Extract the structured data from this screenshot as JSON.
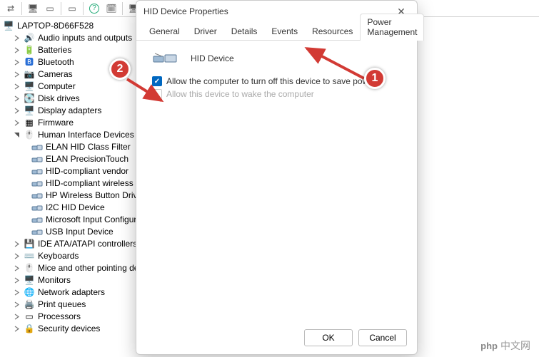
{
  "toolbar": {
    "icons": [
      "arrow",
      "monitor",
      "square",
      "square",
      "help",
      "calendar",
      "device"
    ]
  },
  "computer_name": "LAPTOP-8D66F528",
  "tree": [
    {
      "label": "Audio inputs and outputs",
      "kind": "speaker",
      "exp": true
    },
    {
      "label": "Batteries",
      "kind": "battery",
      "exp": true
    },
    {
      "label": "Bluetooth",
      "kind": "bt",
      "exp": true
    },
    {
      "label": "Cameras",
      "kind": "camera",
      "exp": true
    },
    {
      "label": "Computer",
      "kind": "computer",
      "exp": true
    },
    {
      "label": "Disk drives",
      "kind": "disk",
      "exp": true
    },
    {
      "label": "Display adapters",
      "kind": "display",
      "exp": true
    },
    {
      "label": "Firmware",
      "kind": "firmware",
      "exp": true
    },
    {
      "label": "Human Interface Devices",
      "kind": "hid",
      "exp": true,
      "open": true,
      "children": [
        {
          "label": "ELAN HID Class Filter"
        },
        {
          "label": "ELAN PrecisionTouch"
        },
        {
          "label": "HID-compliant vendor"
        },
        {
          "label": "HID-compliant wireless"
        },
        {
          "label": "HP Wireless Button Driver"
        },
        {
          "label": "I2C HID Device"
        },
        {
          "label": "Microsoft Input Configuration"
        },
        {
          "label": "USB Input Device"
        }
      ]
    },
    {
      "label": "IDE ATA/ATAPI controllers",
      "kind": "ide",
      "exp": true
    },
    {
      "label": "Keyboards",
      "kind": "keyboard",
      "exp": true
    },
    {
      "label": "Mice and other pointing devices",
      "kind": "mouse",
      "exp": true
    },
    {
      "label": "Monitors",
      "kind": "monitor",
      "exp": true
    },
    {
      "label": "Network adapters",
      "kind": "net",
      "exp": true
    },
    {
      "label": "Print queues",
      "kind": "print",
      "exp": true
    },
    {
      "label": "Processors",
      "kind": "cpu",
      "exp": true
    },
    {
      "label": "Security devices",
      "kind": "sec",
      "exp": true
    }
  ],
  "dialog": {
    "title": "HID Device Properties",
    "tabs": [
      "General",
      "Driver",
      "Details",
      "Events",
      "Resources",
      "Power Management"
    ],
    "active_tab": 5,
    "device_name": "HID Device",
    "opt1": "Allow the computer to turn off this device to save power",
    "opt2": "Allow this device to wake the computer",
    "ok": "OK",
    "cancel": "Cancel"
  },
  "badges": {
    "b1": "1",
    "b2": "2"
  },
  "watermark": {
    "brand": "php",
    "text": "中文网"
  }
}
